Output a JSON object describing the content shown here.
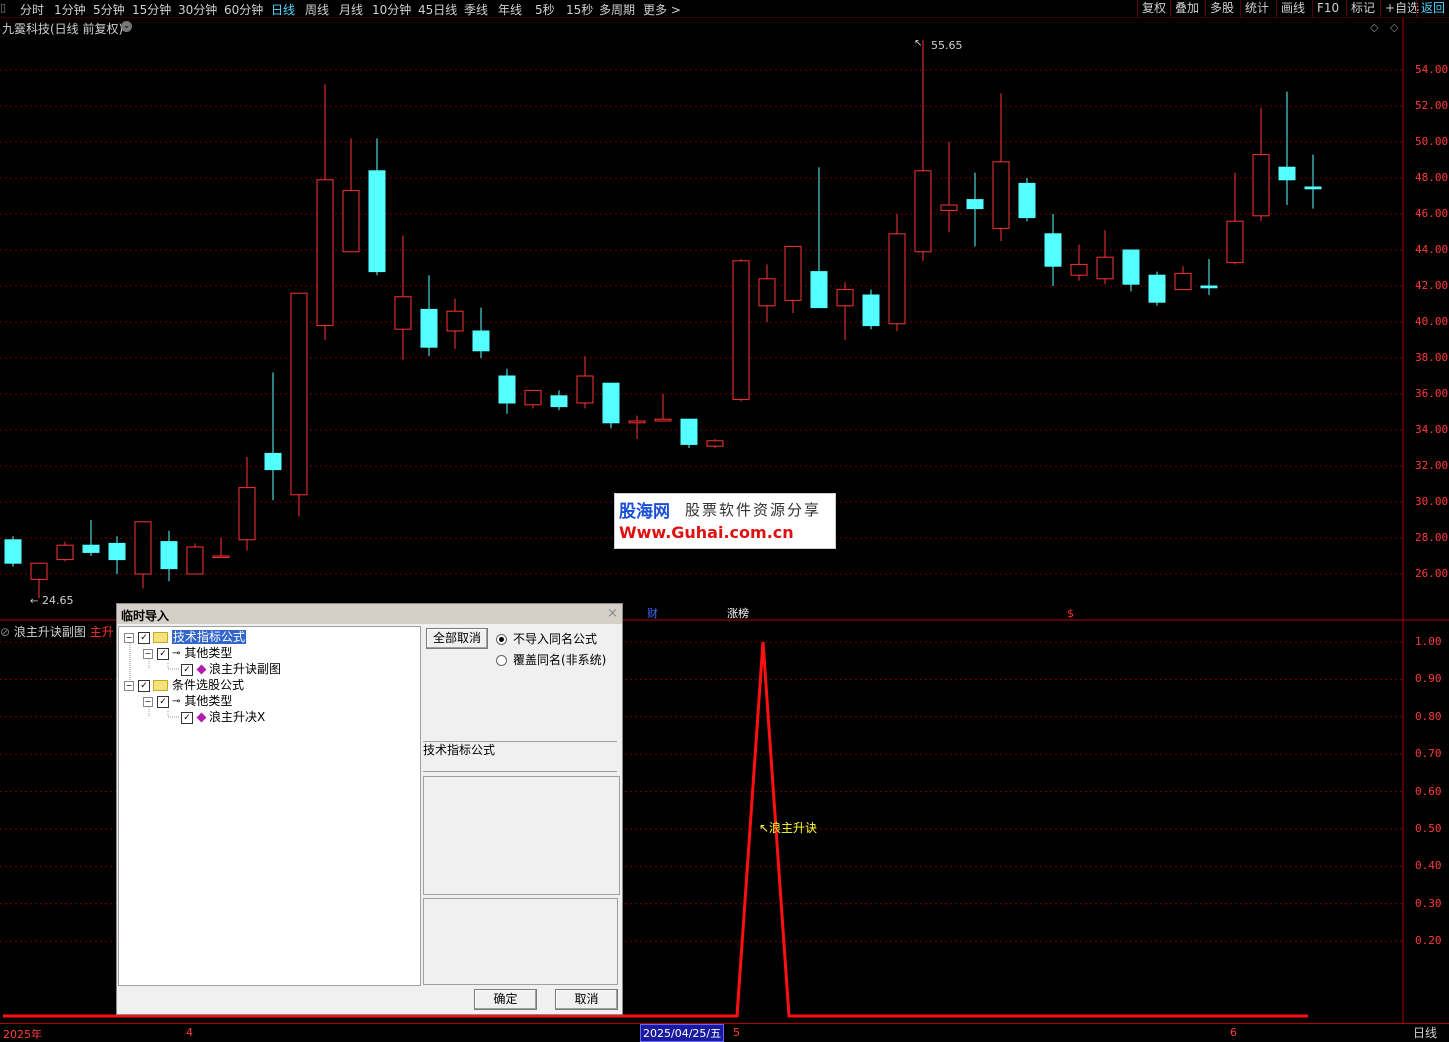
{
  "toolbar": {
    "periods": [
      "分时",
      "1分钟",
      "5分钟",
      "15分钟",
      "30分钟",
      "60分钟",
      "日线",
      "周线",
      "月线",
      "10分钟",
      "45日线",
      "季线",
      "年线",
      "5秒",
      "15秒",
      "多周期",
      "更多 >"
    ],
    "active_period": "日线",
    "right_buttons": [
      "复权",
      "叠加",
      "多股",
      "统计",
      "画线",
      "F10",
      "标记",
      "+自选",
      "返回"
    ]
  },
  "chart": {
    "title": "九霙科技(日线 前复权)",
    "max_label": "55.65",
    "min_label": "24.65",
    "price_ticks": [
      "54.00",
      "52.00",
      "50.00",
      "48.00",
      "46.00",
      "44.00",
      "42.00",
      "40.00",
      "38.00",
      "36.00",
      "34.00",
      "32.00",
      "30.00",
      "28.00",
      "26.00"
    ],
    "markers": {
      "cai": "财",
      "zhangting": "涨榜",
      "dollar": "$"
    },
    "colors": {
      "up": "#ff3232",
      "down": "#54ffff",
      "grid": "#7a0000"
    }
  },
  "chart_data": {
    "type": "candlestick",
    "ylim": [
      24,
      56
    ],
    "candles": [
      {
        "o": 27.9,
        "h": 28.1,
        "l": 26.4,
        "c": 26.6
      },
      {
        "o": 25.7,
        "h": 26.6,
        "l": 24.65,
        "c": 26.6
      },
      {
        "o": 26.8,
        "h": 27.8,
        "l": 26.7,
        "c": 27.6
      },
      {
        "o": 27.6,
        "h": 29.0,
        "l": 27.0,
        "c": 27.2
      },
      {
        "o": 27.7,
        "h": 28.1,
        "l": 26.0,
        "c": 26.8
      },
      {
        "o": 26.0,
        "h": 28.9,
        "l": 25.2,
        "c": 28.9
      },
      {
        "o": 27.8,
        "h": 28.4,
        "l": 25.6,
        "c": 26.3
      },
      {
        "o": 26.0,
        "h": 27.7,
        "l": 26.0,
        "c": 27.5
      },
      {
        "o": 27.0,
        "h": 28.0,
        "l": 26.9,
        "c": 27.0
      },
      {
        "o": 27.9,
        "h": 32.5,
        "l": 27.3,
        "c": 30.8
      },
      {
        "o": 32.7,
        "h": 37.2,
        "l": 30.1,
        "c": 31.8
      },
      {
        "o": 30.4,
        "h": 41.6,
        "l": 29.2,
        "c": 41.6
      },
      {
        "o": 39.8,
        "h": 53.2,
        "l": 39.0,
        "c": 47.9
      },
      {
        "o": 43.9,
        "h": 50.2,
        "l": 43.9,
        "c": 47.3
      },
      {
        "o": 48.4,
        "h": 50.2,
        "l": 42.6,
        "c": 42.8
      },
      {
        "o": 39.6,
        "h": 44.8,
        "l": 37.9,
        "c": 41.4
      },
      {
        "o": 40.7,
        "h": 42.6,
        "l": 38.1,
        "c": 38.6
      },
      {
        "o": 39.5,
        "h": 41.3,
        "l": 38.5,
        "c": 40.6
      },
      {
        "o": 39.5,
        "h": 40.8,
        "l": 38.0,
        "c": 38.4
      },
      {
        "o": 37.0,
        "h": 37.4,
        "l": 34.9,
        "c": 35.5
      },
      {
        "o": 35.4,
        "h": 36.2,
        "l": 35.2,
        "c": 36.2
      },
      {
        "o": 35.9,
        "h": 36.2,
        "l": 35.1,
        "c": 35.3
      },
      {
        "o": 35.5,
        "h": 38.1,
        "l": 35.2,
        "c": 37.0
      },
      {
        "o": 36.6,
        "h": 36.6,
        "l": 34.1,
        "c": 34.4
      },
      {
        "o": 34.4,
        "h": 34.8,
        "l": 33.5,
        "c": 34.5
      },
      {
        "o": 34.5,
        "h": 36.0,
        "l": 34.5,
        "c": 34.6
      },
      {
        "o": 34.6,
        "h": 34.6,
        "l": 33.0,
        "c": 33.2
      },
      {
        "o": 33.1,
        "h": 33.5,
        "l": 33.0,
        "c": 33.4
      },
      {
        "o": 35.7,
        "h": 43.5,
        "l": 35.6,
        "c": 43.4
      },
      {
        "o": 40.9,
        "h": 43.2,
        "l": 40.0,
        "c": 42.4
      },
      {
        "o": 41.2,
        "h": 44.2,
        "l": 40.5,
        "c": 44.2
      },
      {
        "o": 42.8,
        "h": 48.6,
        "l": 40.8,
        "c": 40.8
      },
      {
        "o": 40.9,
        "h": 42.2,
        "l": 39.0,
        "c": 41.8
      },
      {
        "o": 41.5,
        "h": 41.8,
        "l": 39.6,
        "c": 39.8
      },
      {
        "o": 39.9,
        "h": 46.0,
        "l": 39.5,
        "c": 44.9
      },
      {
        "o": 43.9,
        "h": 55.65,
        "l": 43.4,
        "c": 48.4
      },
      {
        "o": 46.2,
        "h": 50.0,
        "l": 45.0,
        "c": 46.5
      },
      {
        "o": 46.8,
        "h": 48.3,
        "l": 44.2,
        "c": 46.3
      },
      {
        "o": 45.2,
        "h": 52.7,
        "l": 44.5,
        "c": 48.9
      },
      {
        "o": 47.7,
        "h": 48.0,
        "l": 45.6,
        "c": 45.8
      },
      {
        "o": 44.9,
        "h": 46.0,
        "l": 42.0,
        "c": 43.1
      },
      {
        "o": 42.6,
        "h": 44.3,
        "l": 42.3,
        "c": 43.2
      },
      {
        "o": 42.4,
        "h": 45.1,
        "l": 42.1,
        "c": 43.6
      },
      {
        "o": 44.0,
        "h": 44.0,
        "l": 41.7,
        "c": 42.1
      },
      {
        "o": 42.6,
        "h": 42.8,
        "l": 40.9,
        "c": 41.1
      },
      {
        "o": 41.8,
        "h": 43.1,
        "l": 41.8,
        "c": 42.7
      },
      {
        "o": 42.0,
        "h": 43.5,
        "l": 41.5,
        "c": 41.9
      },
      {
        "o": 43.3,
        "h": 48.3,
        "l": 43.2,
        "c": 45.6
      },
      {
        "o": 45.9,
        "h": 51.9,
        "l": 45.6,
        "c": 49.3
      },
      {
        "o": 48.6,
        "h": 52.8,
        "l": 46.5,
        "c": 47.9
      },
      {
        "o": 47.5,
        "h": 49.3,
        "l": 46.3,
        "c": 47.4
      }
    ],
    "indicator": {
      "name": "浪主升诀",
      "ylim": [
        0,
        1.05
      ],
      "ticks": [
        "1.00",
        "0.90",
        "0.80",
        "0.70",
        "0.60",
        "0.50",
        "0.40",
        "0.30",
        "0.20"
      ],
      "x": [
        0,
        27,
        28,
        29,
        30,
        50
      ],
      "values": [
        0,
        0,
        0,
        1,
        0,
        0
      ]
    }
  },
  "indicator_panel": {
    "title": "浪主升诀副图",
    "main_tag": "主升",
    "curve_label": "↖浪主升诀"
  },
  "watermark": {
    "logo": "股海网",
    "subtitle": "股票软件资源分享",
    "url": "Www.Guhai.com.cn"
  },
  "dialog": {
    "title": "临时导入",
    "close": "×",
    "tree": [
      {
        "label": "技术指标公式",
        "checked": true
      },
      {
        "label": "其他类型",
        "checked": true
      },
      {
        "label": "浪主升诀副图",
        "checked": true
      },
      {
        "label": "条件选股公式",
        "checked": true
      },
      {
        "label": "其他类型",
        "checked": true
      },
      {
        "label": "浪主升决X",
        "checked": true
      }
    ],
    "clear_all": "全部取消",
    "radio_keep": "不导入同名公式",
    "radio_overwrite": "覆盖同名(非系统)",
    "info_label": "技术指标公式",
    "ok": "确定",
    "cancel": "取消"
  },
  "bottom_axis": {
    "labels": [
      "2025年",
      "4",
      "5",
      "6"
    ],
    "current_date": "2025/04/25/五",
    "period_mode": "日线"
  }
}
